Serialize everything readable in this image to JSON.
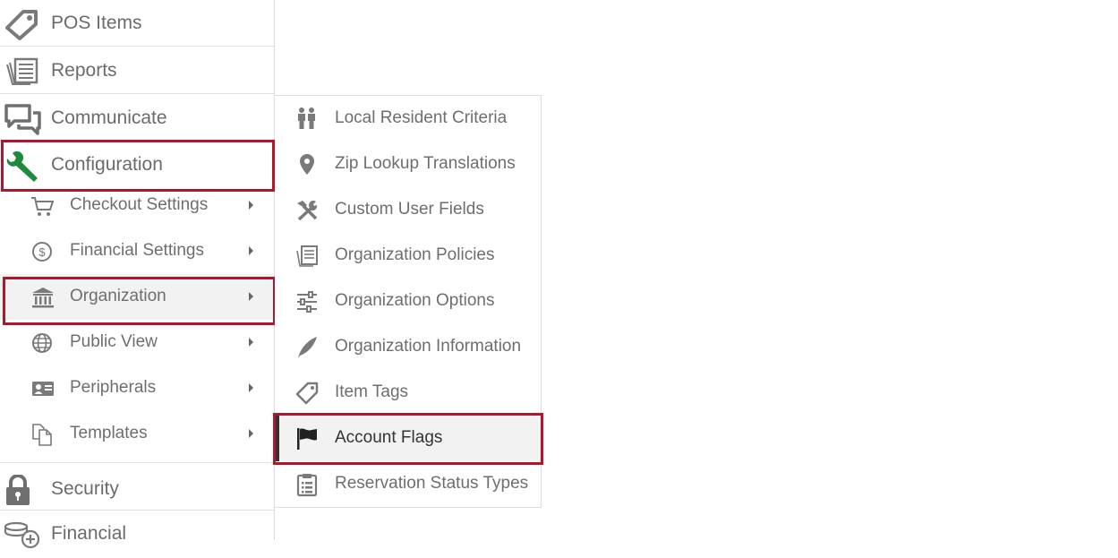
{
  "sidebar": {
    "main_items": [
      {
        "label": "POS Items",
        "icon": "tag-icon"
      },
      {
        "label": "Reports",
        "icon": "reports-icon"
      },
      {
        "label": "Communicate",
        "icon": "chat-icon"
      },
      {
        "label": "Configuration",
        "icon": "wrench-icon"
      },
      {
        "label": "Security",
        "icon": "lock-icon"
      },
      {
        "label": "Financial",
        "icon": "coins-icon"
      }
    ],
    "config_sub_items": [
      {
        "label": "Checkout Settings",
        "icon": "cart-icon"
      },
      {
        "label": "Financial Settings",
        "icon": "dollar-circle-icon"
      },
      {
        "label": "Organization",
        "icon": "bank-icon",
        "selected": true
      },
      {
        "label": "Public View",
        "icon": "globe-icon"
      },
      {
        "label": "Peripherals",
        "icon": "id-card-icon"
      },
      {
        "label": "Templates",
        "icon": "documents-icon"
      }
    ]
  },
  "flyout": {
    "items": [
      {
        "label": "Local Resident Criteria",
        "icon": "people-icon"
      },
      {
        "label": "Zip Lookup Translations",
        "icon": "map-pin-icon"
      },
      {
        "label": "Custom User Fields",
        "icon": "tools-icon"
      },
      {
        "label": "Organization Policies",
        "icon": "policies-icon"
      },
      {
        "label": "Organization Options",
        "icon": "sliders-icon"
      },
      {
        "label": "Organization Information",
        "icon": "feather-icon"
      },
      {
        "label": "Item Tags",
        "icon": "tag-icon"
      },
      {
        "label": "Account Flags",
        "icon": "flag-icon",
        "selected": true
      },
      {
        "label": "Reservation Status Types",
        "icon": "clipboard-icon"
      }
    ]
  },
  "colors": {
    "highlight_border": "#b0152e",
    "config_icon": "#1e8a3c",
    "selected_bg": "#f2f2f2",
    "text": "#6e6e6e"
  }
}
